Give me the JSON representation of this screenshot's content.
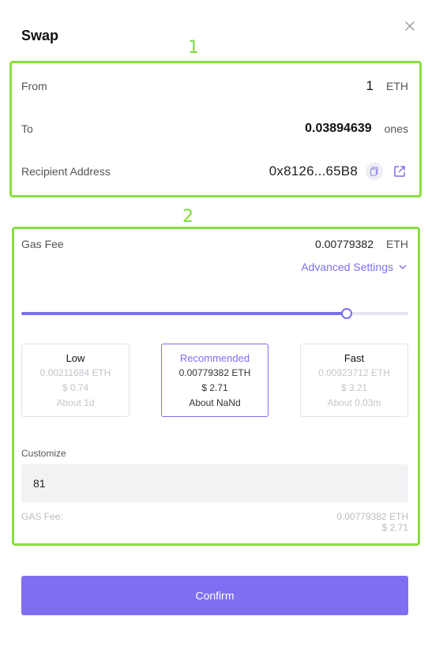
{
  "header": {
    "title": "Swap",
    "close_icon": "close-icon"
  },
  "annotations": {
    "marker1": "1",
    "marker2": "2",
    "color": "#86e03f"
  },
  "swap": {
    "from_label": "From",
    "from_value": "1",
    "from_unit": "ETH",
    "to_label": "To",
    "to_value": "0.03894639",
    "to_unit": "ones",
    "recipient_label": "Recipient Address",
    "recipient_value": "0x8126...65B8",
    "copy_icon": "copy-icon",
    "external_link_icon": "external-link-icon"
  },
  "gas": {
    "label": "Gas Fee",
    "value": "0.00779382",
    "unit": "ETH",
    "advanced_label": "Advanced Settings",
    "slider_level": 0.84,
    "options": [
      {
        "name": "Low",
        "eth": "0.00211684 ETH",
        "usd": "$ 0.74",
        "time": "About 1d"
      },
      {
        "name": "Recommended",
        "eth": "0.00779382 ETH",
        "usd": "$ 2.71",
        "time": "About NaNd"
      },
      {
        "name": "Fast",
        "eth": "0.00923712 ETH",
        "usd": "$ 3.21",
        "time": "About 0.03m"
      }
    ],
    "selected_option": "Recommended",
    "customize_label": "Customize",
    "customize_value": "81",
    "summary_label": "GAS Fee:",
    "summary_eth": "0.00779382 ETH",
    "summary_usd": "$ 2.71"
  },
  "actions": {
    "confirm_label": "Confirm"
  },
  "colors": {
    "accent": "#7c6ff0",
    "button": "#7e6ef2",
    "input_bg": "#f2f2f5"
  }
}
